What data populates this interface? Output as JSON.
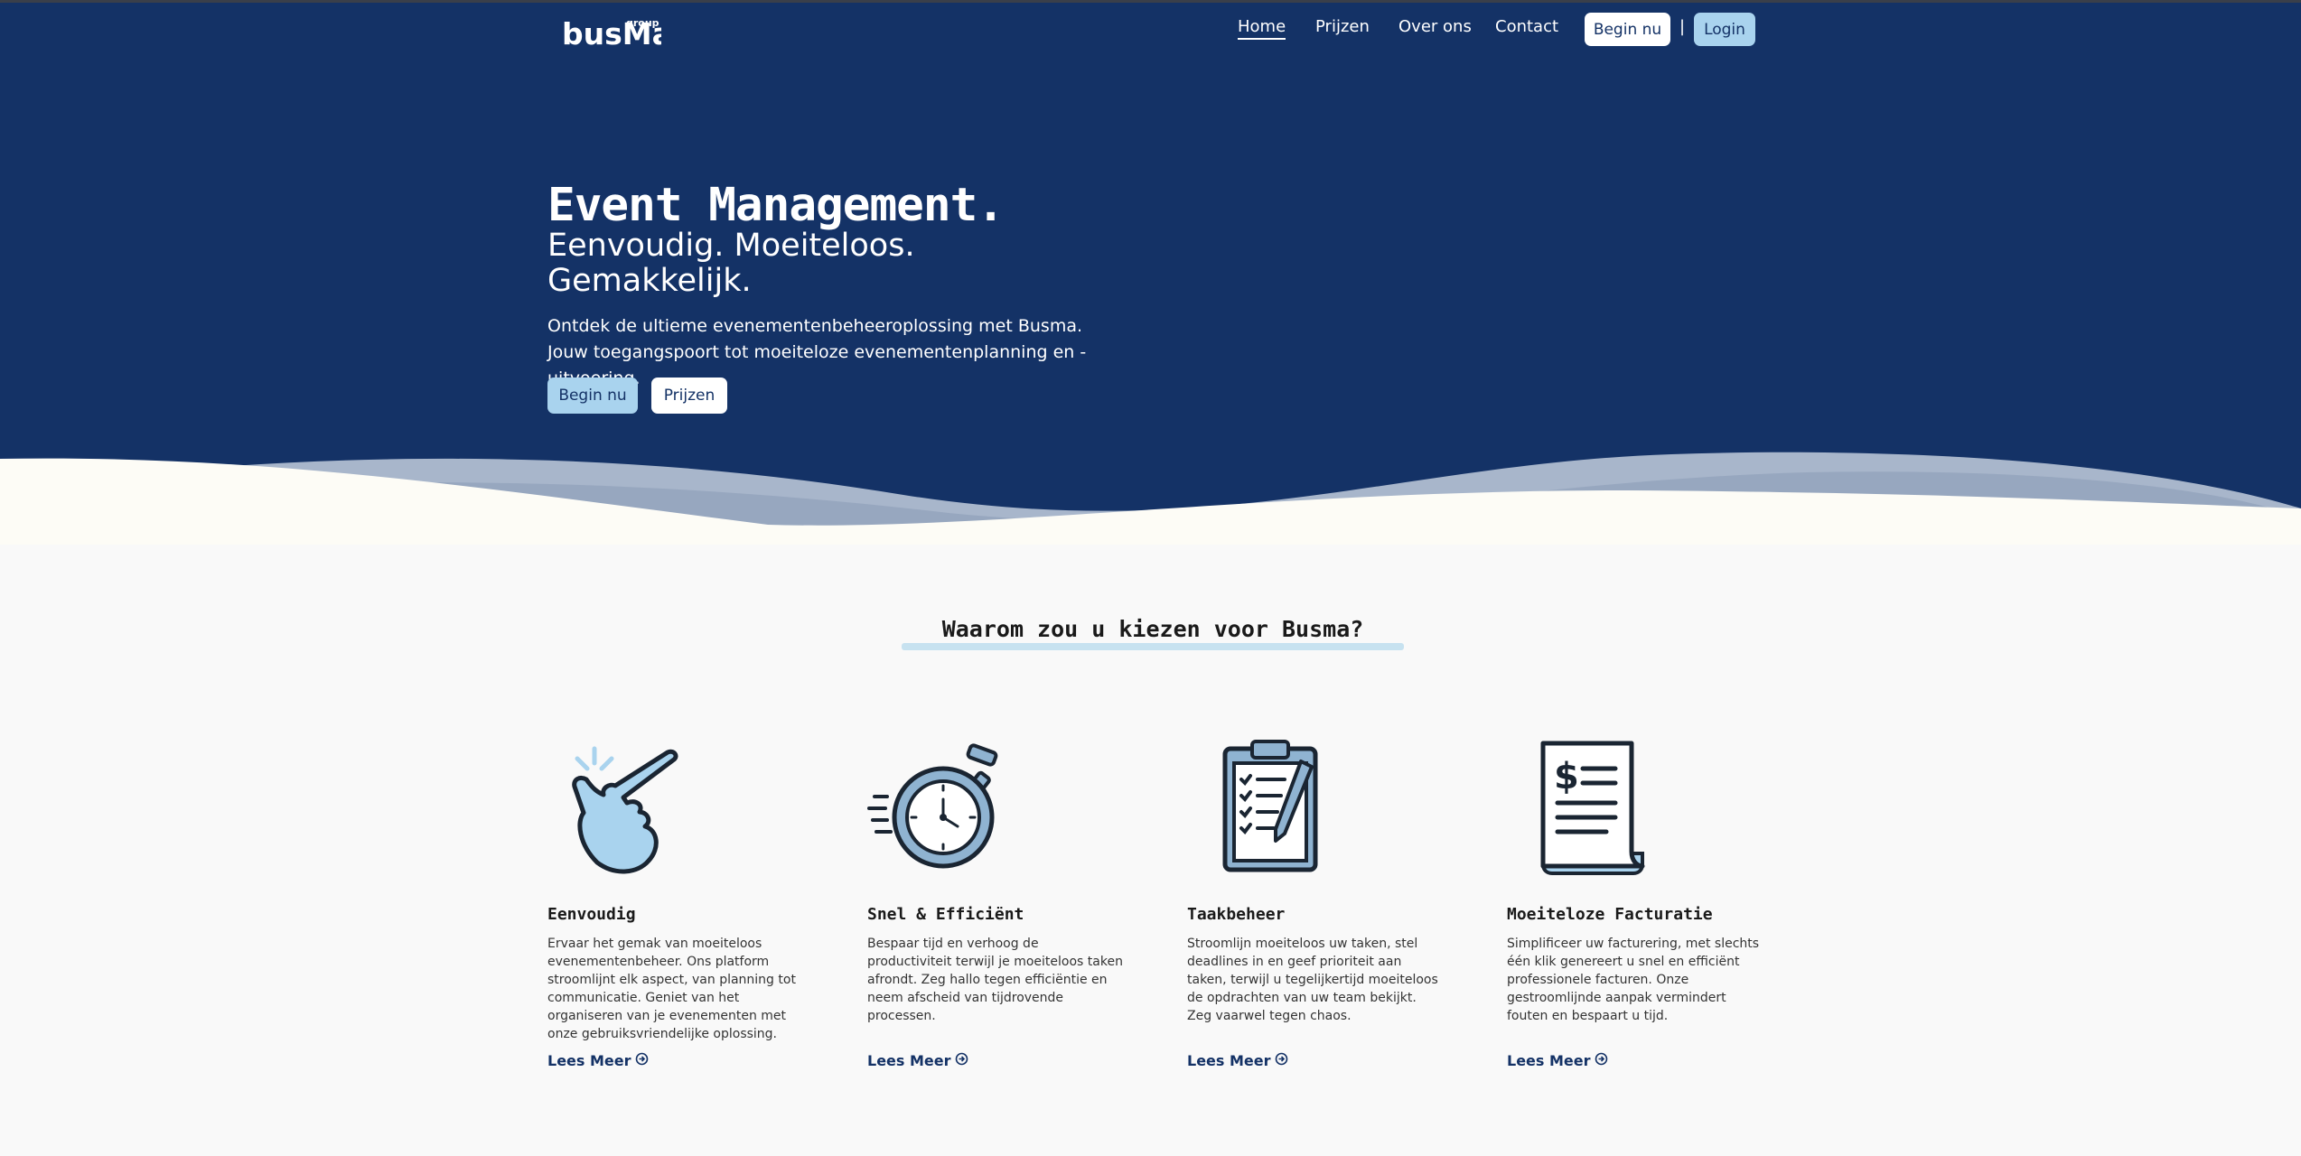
{
  "nav": {
    "logo_main": "busMa",
    "logo_sub": "group",
    "links": [
      "Home",
      "Prijzen",
      "Over ons",
      "Contact"
    ],
    "begin_label": "Begin nu",
    "separator": "|",
    "login_label": "Login"
  },
  "hero": {
    "title": "Event Management.",
    "subtitle_line1": "Eenvoudig. Moeiteloos.",
    "subtitle_line2": "Gemakkelijk.",
    "description": "Ontdek de ultieme evenementenbeheeroplossing met Busma. Jouw toegangspoort tot moeiteloze evenementenplanning en -uitvoering.",
    "cta_primary": "Begin nu",
    "cta_secondary": "Prijzen"
  },
  "why": {
    "title": "Waarom zou u kiezen voor Busma?"
  },
  "features": [
    {
      "icon": "snap-fingers-icon",
      "title": "Eenvoudig",
      "text": "Ervaar het gemak van moeiteloos evenementenbeheer. Ons platform stroomlijnt elk aspect, van planning tot communicatie. Geniet van het organiseren van je evenementen met onze gebruiksvriendelijke oplossing.",
      "link": "Lees Meer"
    },
    {
      "icon": "stopwatch-icon",
      "title": "Snel & Efficiënt",
      "text": "Bespaar tijd en verhoog de productiviteit terwijl je moeiteloos taken afrondt. Zeg hallo tegen efficiëntie en neem afscheid van tijdrovende processen.",
      "link": "Lees Meer"
    },
    {
      "icon": "clipboard-checklist-icon",
      "title": "Taakbeheer",
      "text": "Stroomlijn moeiteloos uw taken, stel deadlines in en geef prioriteit aan taken, terwijl u tegelijkertijd moeiteloos de opdrachten van uw team bekijkt. Zeg vaarwel tegen chaos.",
      "link": "Lees Meer"
    },
    {
      "icon": "invoice-dollar-icon",
      "title": "Moeiteloze Facturatie",
      "text": "Simplificeer uw facturering, met slechts één klik genereert u snel en efficiënt professionele facturen. Onze gestroomlijnde aanpak vermindert fouten en bespaart u tijd.",
      "link": "Lees Meer"
    }
  ],
  "colors": {
    "navy": "#143266",
    "light_blue": "#a9d3ee",
    "background": "#f9f9f9"
  }
}
